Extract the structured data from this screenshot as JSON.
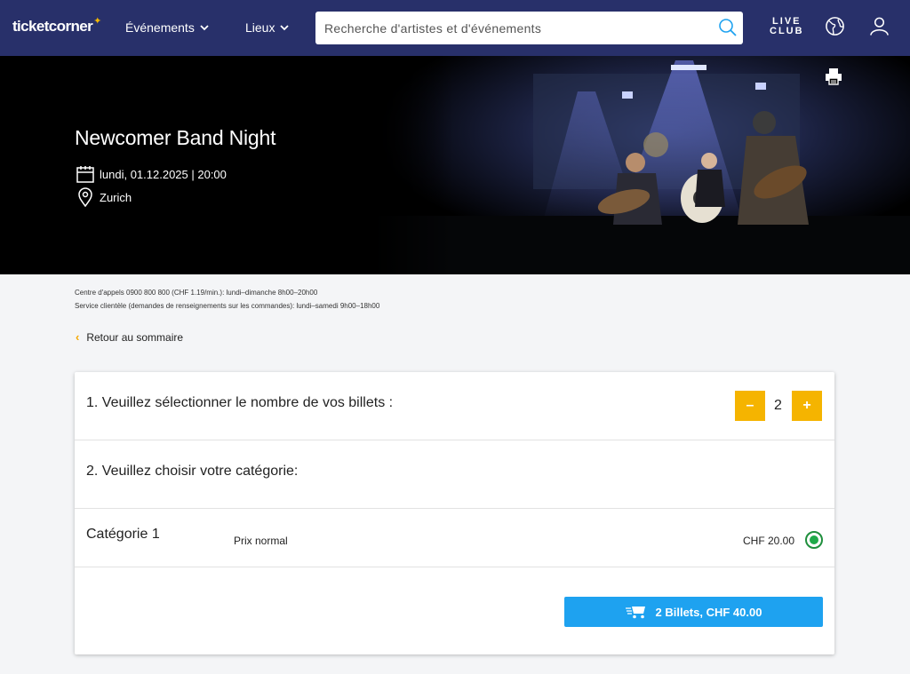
{
  "header": {
    "logo": "ticketcorner",
    "nav_events": "Événements",
    "nav_venues": "Lieux",
    "search_placeholder": "Recherche d'artistes et d'événements",
    "live_club_line1": "LIVE",
    "live_club_line2": "CLUB"
  },
  "event": {
    "title": "Newcomer Band Night",
    "datetime": "lundi, 01.12.2025 | 20:00",
    "location": "Zurich"
  },
  "info": {
    "call_center": "Centre d'appels 0900 800 800 (CHF 1.19/min.): lundi–dimanche 8h00–20h00",
    "customer_service": "Service clientèle (demandes de renseignements sur les commandes): lundi–samedi 9h00–18h00"
  },
  "back_link": "Retour au sommaire",
  "booking": {
    "step1": "1. Veuillez sélectionner le nombre de vos billets :",
    "minus": "–",
    "quantity": "2",
    "plus": "+",
    "step2": "2. Veuillez choisir votre catégorie:",
    "category_name": "Catégorie 1",
    "price_type": "Prix normal",
    "price": "CHF 20.00",
    "cta": "2 Billets, CHF 40.00"
  },
  "colors": {
    "header_bg": "#28306a",
    "accent_yellow": "#f5b400",
    "cta_blue": "#1ea2f0",
    "radio_green": "#1faa49"
  },
  "icons": [
    "chevron-down-icon",
    "search-icon",
    "globe-icon",
    "user-icon",
    "print-icon",
    "calendar-icon",
    "location-pin-icon",
    "chevron-left-icon",
    "cart-icon"
  ]
}
